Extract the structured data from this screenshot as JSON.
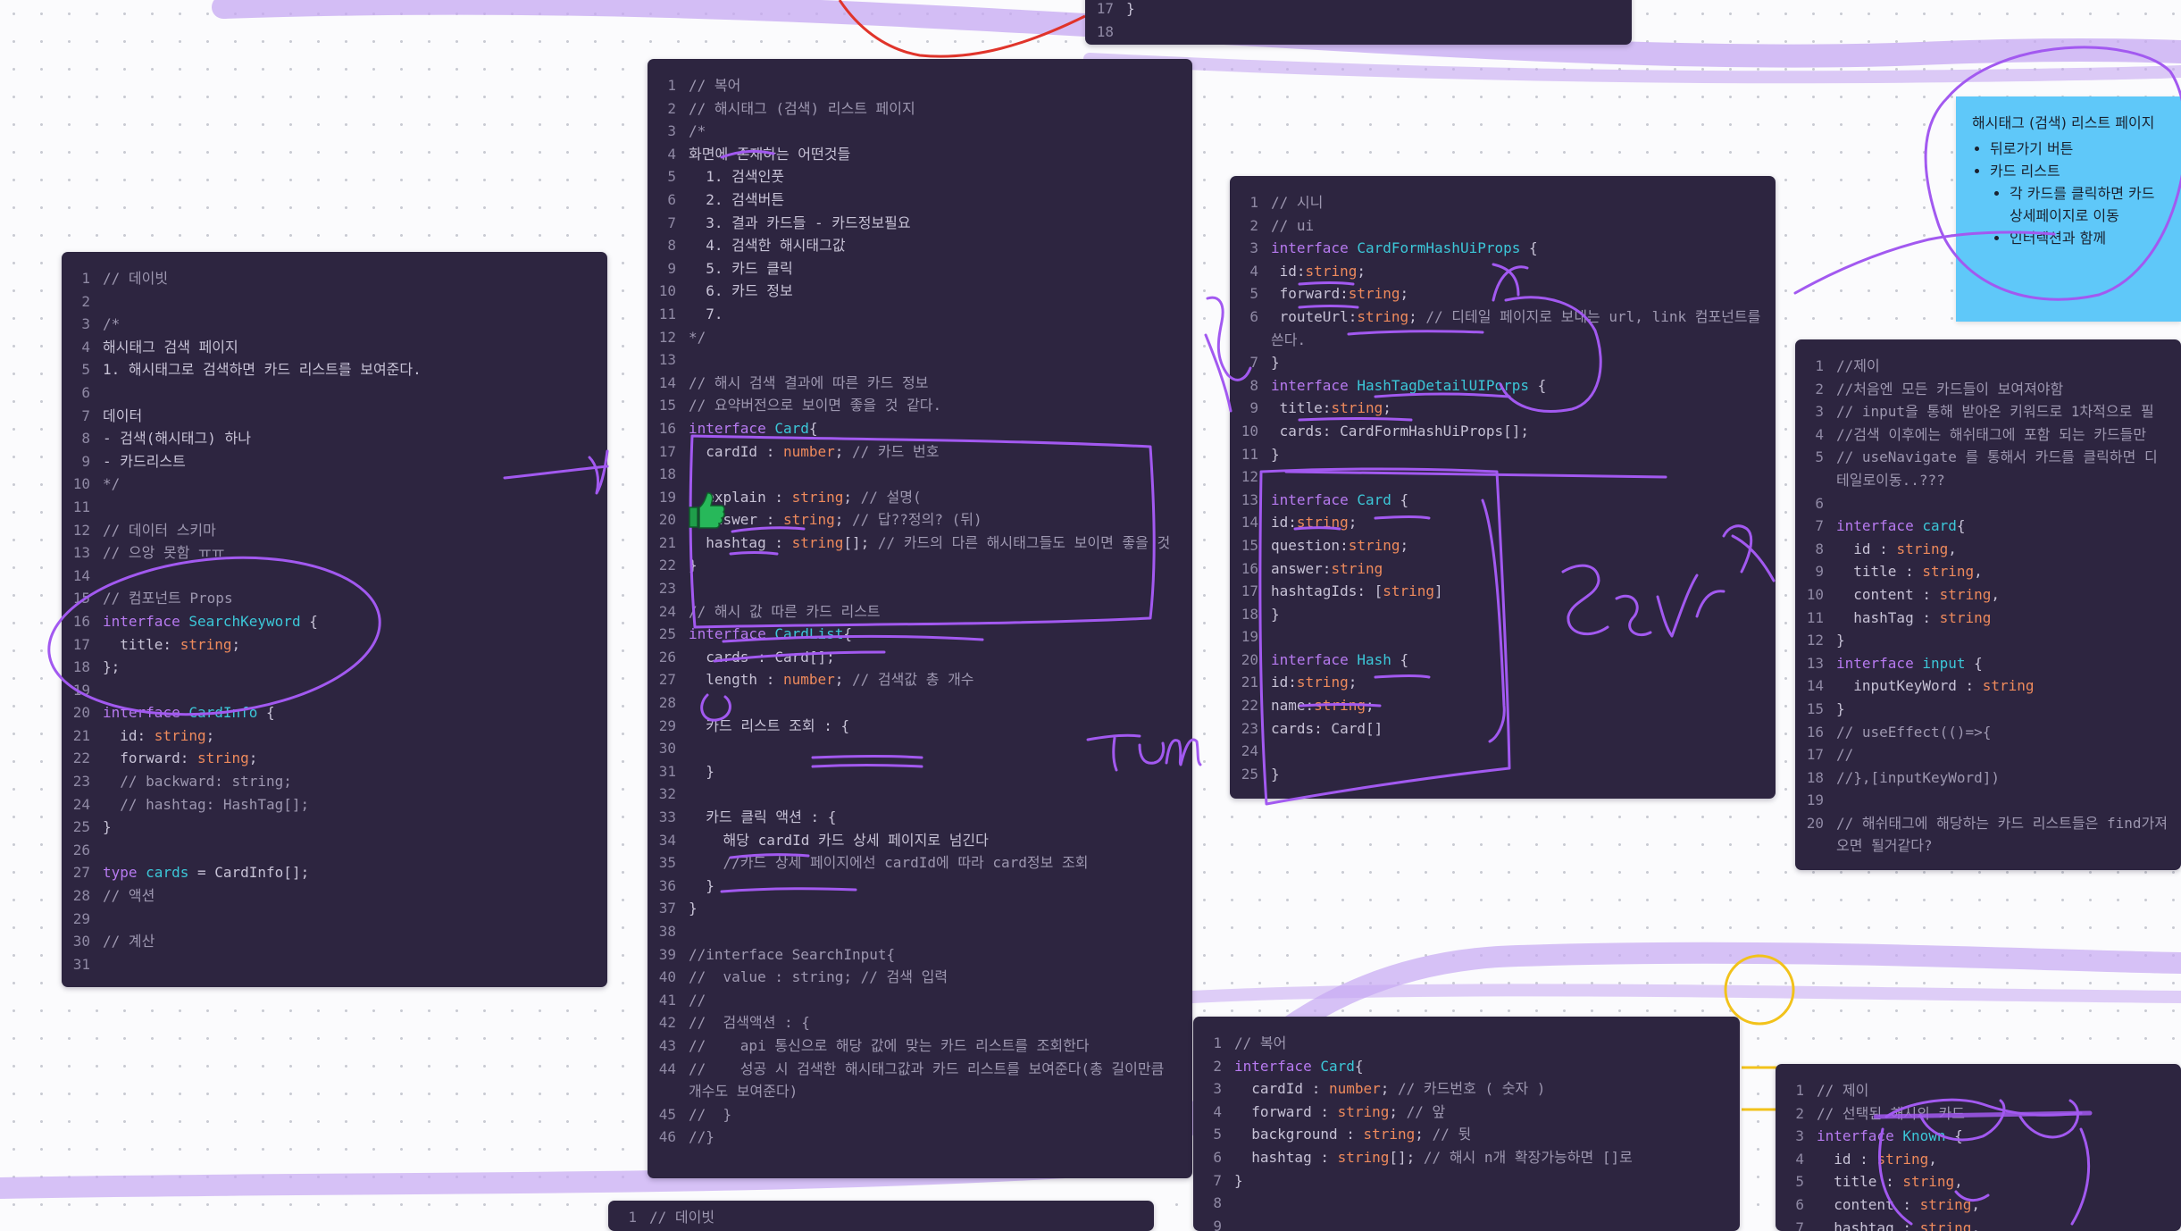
{
  "colors": {
    "board_bg": "#fbfbfd",
    "code_bg": "#2d2540",
    "ink_purple": "#a259f0",
    "highlighter_purple": "#c6a8f2",
    "ink_red": "#e0342b",
    "ink_yellow": "#f2c21b",
    "sticky_blue": "#5fc8f9",
    "keyword": "#b77af0",
    "type": "#ee8a5c",
    "identifier": "#3cc7d8",
    "comment": "#9d97b0"
  },
  "stickers": {
    "thumbs_up": "thumbs-up-icon"
  },
  "sticky_note": {
    "title": "해시태그 (검색) 리스트 페이지",
    "items": [
      "뒤로가기 버튼",
      "카드 리스트"
    ],
    "subitems": [
      "각 카드를 클릭하면 카드 상세페이지로 이동",
      "인터렉션과 함께"
    ]
  },
  "blocks": [
    {
      "id": "top-center",
      "lines": [
        {
          "n": "17",
          "t": "}"
        },
        {
          "n": "18",
          "t": ""
        }
      ]
    },
    {
      "id": "daebit",
      "lines": [
        {
          "n": "1",
          "t": "// 데이빗"
        },
        {
          "n": "2",
          "t": ""
        },
        {
          "n": "3",
          "t": "/*"
        },
        {
          "n": "4",
          "t": "해시태그 검색 페이지"
        },
        {
          "n": "5",
          "t": "1. 해시태그로 검색하면 카드 리스트를 보여준다."
        },
        {
          "n": "6",
          "t": ""
        },
        {
          "n": "7",
          "t": "데이터"
        },
        {
          "n": "8",
          "t": "- 검색(해시태그) 하나"
        },
        {
          "n": "9",
          "t": "- 카드리스트"
        },
        {
          "n": "10",
          "t": "*/"
        },
        {
          "n": "11",
          "t": ""
        },
        {
          "n": "12",
          "t": "// 데이터 스키마"
        },
        {
          "n": "13",
          "t": "// 으앙 못함 ㅠㅠ"
        },
        {
          "n": "14",
          "t": ""
        },
        {
          "n": "15",
          "t": "// 컴포넌트 Props"
        },
        {
          "n": "16",
          "t": "interface SearchKeyword {"
        },
        {
          "n": "17",
          "t": "  title: string;"
        },
        {
          "n": "18",
          "t": "};"
        },
        {
          "n": "19",
          "t": ""
        },
        {
          "n": "20",
          "t": "interface CardInfo {"
        },
        {
          "n": "21",
          "t": "  id: string;"
        },
        {
          "n": "22",
          "t": "  forward: string;"
        },
        {
          "n": "23",
          "t": "  // backward: string;"
        },
        {
          "n": "24",
          "t": "  // hashtag: HashTag[];"
        },
        {
          "n": "25",
          "t": "}"
        },
        {
          "n": "26",
          "t": ""
        },
        {
          "n": "27",
          "t": "type cards = CardInfo[];"
        },
        {
          "n": "28",
          "t": "// 액션"
        },
        {
          "n": "29",
          "t": ""
        },
        {
          "n": "30",
          "t": "// 계산"
        },
        {
          "n": "31",
          "t": ""
        }
      ]
    },
    {
      "id": "bokeo-main",
      "lines": [
        {
          "n": "1",
          "t": "// 복어"
        },
        {
          "n": "2",
          "t": "// 해시태그 (검색) 리스트 페이지"
        },
        {
          "n": "3",
          "t": "/*"
        },
        {
          "n": "4",
          "t": "화면에 존재하는 어떤것들"
        },
        {
          "n": "5",
          "t": "  1. 검색인풋"
        },
        {
          "n": "6",
          "t": "  2. 검색버튼"
        },
        {
          "n": "7",
          "t": "  3. 결과 카드들 - 카드정보필요"
        },
        {
          "n": "8",
          "t": "  4. 검색한 해시태그값"
        },
        {
          "n": "9",
          "t": "  5. 카드 클릭"
        },
        {
          "n": "10",
          "t": "  6. 카드 정보"
        },
        {
          "n": "11",
          "t": "  7."
        },
        {
          "n": "12",
          "t": "*/"
        },
        {
          "n": "13",
          "t": ""
        },
        {
          "n": "14",
          "t": "// 해시 검색 결과에 따른 카드 정보"
        },
        {
          "n": "15",
          "t": "// 요약버전으로 보이면 좋을 것 같다."
        },
        {
          "n": "16",
          "t": "interface Card{"
        },
        {
          "n": "17",
          "t": "  cardId : number; // 카드 번호"
        },
        {
          "n": "18",
          "t": ""
        },
        {
          "n": "19",
          "t": "  explain : string; // 설명("
        },
        {
          "n": "20",
          "t": "  answer : string; // 답??정의? (뒤)"
        },
        {
          "n": "21",
          "t": "  hashtag : string[]; // 카드의 다른 해시태그들도 보이면 좋을 것"
        },
        {
          "n": "22",
          "t": "}"
        },
        {
          "n": "23",
          "t": ""
        },
        {
          "n": "24",
          "t": "// 해시 값 따른 카드 리스트"
        },
        {
          "n": "25",
          "t": "interface CardList{"
        },
        {
          "n": "26",
          "t": "  cards : Card[];"
        },
        {
          "n": "27",
          "t": "  length : number; // 검색값 총 개수"
        },
        {
          "n": "28",
          "t": ""
        },
        {
          "n": "29",
          "t": "  카드 리스트 조회 : {"
        },
        {
          "n": "30",
          "t": ""
        },
        {
          "n": "31",
          "t": "  }"
        },
        {
          "n": "32",
          "t": ""
        },
        {
          "n": "33",
          "t": "  카드 클릭 액션 : {"
        },
        {
          "n": "34",
          "t": "    해당 cardId 카드 상세 페이지로 넘긴다"
        },
        {
          "n": "35",
          "t": "    //카드 상세 페이지에선 cardId에 따라 card정보 조회"
        },
        {
          "n": "36",
          "t": "  }"
        },
        {
          "n": "37",
          "t": "}"
        },
        {
          "n": "38",
          "t": ""
        },
        {
          "n": "39",
          "t": "//interface SearchInput{"
        },
        {
          "n": "40",
          "t": "//  value : string; // 검색 입력"
        },
        {
          "n": "41",
          "t": "//"
        },
        {
          "n": "42",
          "t": "//  검색액션 : {"
        },
        {
          "n": "43",
          "t": "//    api 통신으로 해당 값에 맞는 카드 리스트를 조회한다"
        },
        {
          "n": "44",
          "t": "//    성공 시 검색한 해시태그값과 카드 리스트를 보여준다(총 길이만큼 개수도 보여준다)"
        },
        {
          "n": "45",
          "t": "//  }"
        },
        {
          "n": "46",
          "t": "//}"
        }
      ]
    },
    {
      "id": "shini",
      "lines": [
        {
          "n": "1",
          "t": "// 시니"
        },
        {
          "n": "2",
          "t": "// ui"
        },
        {
          "n": "3",
          "t": "interface CardFormHashUiProps {"
        },
        {
          "n": "4",
          "t": " id:string;"
        },
        {
          "n": "5",
          "t": " forward:string;"
        },
        {
          "n": "6",
          "t": " routeUrl:string; // 디테일 페이지로 보내는 url, link 컴포넌트를 쓴다."
        },
        {
          "n": "7",
          "t": "}"
        },
        {
          "n": "8",
          "t": "interface HashTagDetailUIPorps {"
        },
        {
          "n": "9",
          "t": " title:string;"
        },
        {
          "n": "10",
          "t": " cards: CardFormHashUiProps[];"
        },
        {
          "n": "11",
          "t": "}"
        },
        {
          "n": "12",
          "t": ""
        },
        {
          "n": "13",
          "t": "interface Card {"
        },
        {
          "n": "14",
          "t": "id:string;"
        },
        {
          "n": "15",
          "t": "question:string;"
        },
        {
          "n": "16",
          "t": "answer:string"
        },
        {
          "n": "17",
          "t": "hashtagIds: [string]"
        },
        {
          "n": "18",
          "t": "}"
        },
        {
          "n": "19",
          "t": ""
        },
        {
          "n": "20",
          "t": "interface Hash {"
        },
        {
          "n": "21",
          "t": "id:string;"
        },
        {
          "n": "22",
          "t": "name:string;"
        },
        {
          "n": "23",
          "t": "cards: Card[]"
        },
        {
          "n": "24",
          "t": ""
        },
        {
          "n": "25",
          "t": "}"
        }
      ]
    },
    {
      "id": "jay",
      "lines": [
        {
          "n": "1",
          "t": "//제이"
        },
        {
          "n": "2",
          "t": "//처음엔 모든 카드들이 보여져야함"
        },
        {
          "n": "3",
          "t": "// input을 통해 받아온 키워드로 1차적으로 필"
        },
        {
          "n": "4",
          "t": "//검색 이후에는 해쉬태그에 포함 되는 카드들만"
        },
        {
          "n": "5",
          "t": "// useNavigate 를 통해서 카드를 클릭하면 디테일로이동..???"
        },
        {
          "n": "6",
          "t": ""
        },
        {
          "n": "7",
          "t": "interface card{"
        },
        {
          "n": "8",
          "t": "  id : string,"
        },
        {
          "n": "9",
          "t": "  title : string,"
        },
        {
          "n": "10",
          "t": "  content : string,"
        },
        {
          "n": "11",
          "t": "  hashTag : string"
        },
        {
          "n": "12",
          "t": "}"
        },
        {
          "n": "13",
          "t": "interface input {"
        },
        {
          "n": "14",
          "t": "  inputKeyWord : string"
        },
        {
          "n": "15",
          "t": "}"
        },
        {
          "n": "16",
          "t": "// useEffect(()=>{"
        },
        {
          "n": "17",
          "t": "//"
        },
        {
          "n": "18",
          "t": "//},[inputKeyWord])"
        },
        {
          "n": "19",
          "t": ""
        },
        {
          "n": "20",
          "t": "// 해쉬태그에 해당하는 카드 리스트들은 find가져오면 될거같다?"
        }
      ]
    },
    {
      "id": "bokeo-small",
      "lines": [
        {
          "n": "1",
          "t": "// 복어"
        },
        {
          "n": "2",
          "t": "interface Card{"
        },
        {
          "n": "3",
          "t": "  cardId : number; // 카드번호 ( 숫자 )"
        },
        {
          "n": "4",
          "t": "  forward : string; // 앞"
        },
        {
          "n": "5",
          "t": "  background : string; // 뒷"
        },
        {
          "n": "6",
          "t": "  hashtag : string[]; // 해시 n개 확장가능하면 []로"
        },
        {
          "n": "7",
          "t": "}"
        },
        {
          "n": "8",
          "t": ""
        },
        {
          "n": "9",
          "t": ""
        }
      ]
    },
    {
      "id": "jay-small",
      "lines": [
        {
          "n": "1",
          "t": "// 제이"
        },
        {
          "n": "2",
          "t": "// 선택된 해시의 카드"
        },
        {
          "n": "3",
          "t": "interface Known {"
        },
        {
          "n": "4",
          "t": "  id : string,"
        },
        {
          "n": "5",
          "t": "  title : string,"
        },
        {
          "n": "6",
          "t": "  content : string,"
        },
        {
          "n": "7",
          "t": "  hashtag : string,"
        }
      ]
    },
    {
      "id": "daebit-bottom",
      "lines": [
        {
          "n": "1",
          "t": "// 데이빗"
        }
      ]
    }
  ]
}
